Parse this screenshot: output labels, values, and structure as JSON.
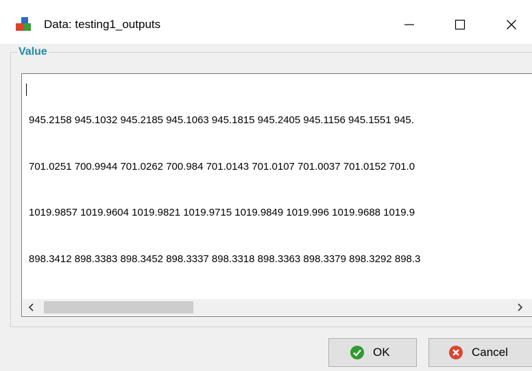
{
  "window": {
    "title": "Data: testing1_outputs",
    "icon": "app-blocks-icon",
    "controls": {
      "minimize": "minimize-icon",
      "maximize": "maximize-icon",
      "close": "close-icon"
    }
  },
  "group": {
    "legend": "Value"
  },
  "value_text": {
    "lines": [
      "945.2158 945.1032 945.2185 945.1063 945.1815 945.2405 945.1156 945.1551 945.",
      "701.0251 700.9944 701.0262 700.984 701.0143 701.0107 701.0037 701.0152 701.0",
      "1019.9857 1019.9604 1019.9821 1019.9715 1019.9849 1019.996 1019.9688 1019.9",
      "898.3412 898.3383 898.3452 898.3337 898.3318 898.3363 898.3379 898.3292 898.3"
    ]
  },
  "scrollbar": {
    "left_arrow": "chevron-left-icon",
    "right_arrow": "chevron-right-icon"
  },
  "buttons": {
    "ok": {
      "label": "OK",
      "icon": "check-circle-icon",
      "color": "#2e9b2e"
    },
    "cancel": {
      "label": "Cancel",
      "icon": "x-circle-icon",
      "color": "#d9452f"
    }
  },
  "colors": {
    "legend": "#1f8aa8",
    "background": "#f0f0f0"
  }
}
